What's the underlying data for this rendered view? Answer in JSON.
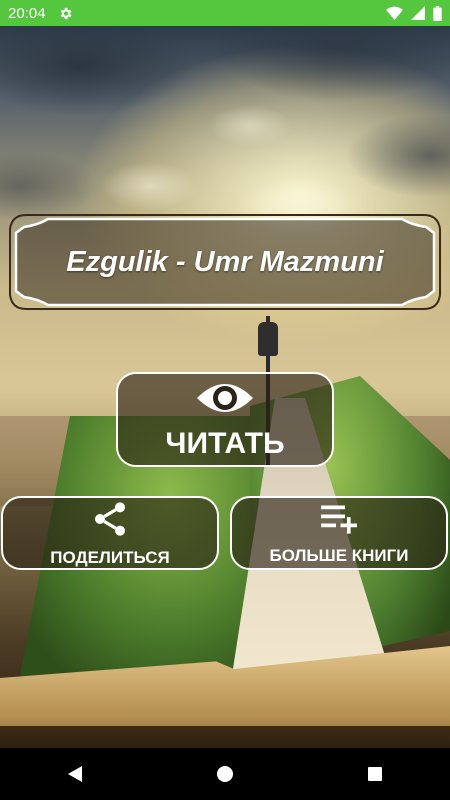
{
  "status_bar": {
    "time": "20:04",
    "icons": [
      "settings-icon",
      "wifi-icon",
      "signal-icon",
      "battery-icon"
    ],
    "background": "#55c73f"
  },
  "title": "Ezgulik - Umr Mazmuni",
  "buttons": {
    "read": {
      "label": "ЧИТАТЬ",
      "icon": "eye-icon"
    },
    "share": {
      "label": "ПОДЕЛИТЬСЯ",
      "icon": "share-icon"
    },
    "more_books": {
      "label": "БОЛЬШЕ КНИГИ",
      "icon": "playlist-add-icon"
    }
  },
  "nav_bar": {
    "icons": [
      "back-icon",
      "home-icon",
      "recents-icon"
    ]
  }
}
